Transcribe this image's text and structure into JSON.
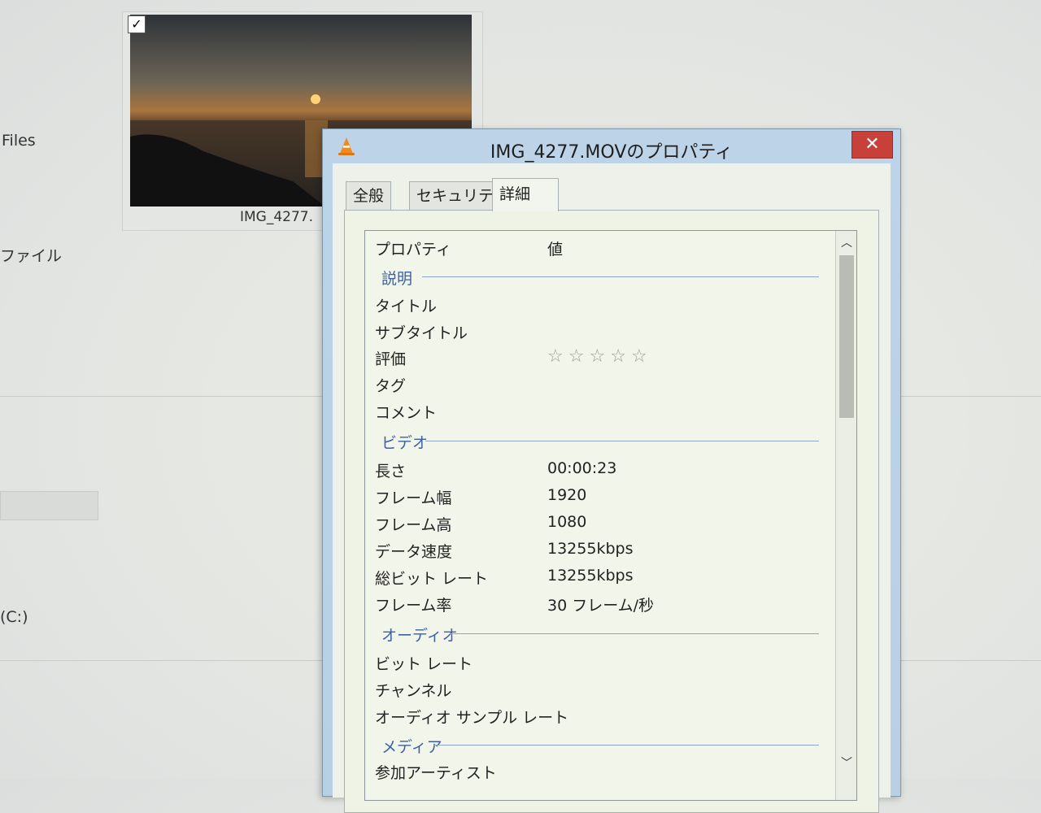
{
  "explorer": {
    "left_items": [
      "Files",
      "ファイル",
      "(C:)"
    ],
    "thumbnail_label": "IMG_4277."
  },
  "dialog": {
    "title": "IMG_4277.MOVのプロパティ",
    "close_glyph": "✕",
    "tabs": [
      {
        "label": "全般",
        "active": false
      },
      {
        "label": "セキュリティ",
        "active": false
      },
      {
        "label": "詳細",
        "active": true
      }
    ],
    "list": {
      "header_property": "プロパティ",
      "header_value": "値",
      "groups": {
        "description": {
          "label": "説明",
          "rows": [
            {
              "label": "タイトル",
              "value": ""
            },
            {
              "label": "サブタイトル",
              "value": ""
            },
            {
              "label": "評価",
              "value": ""
            },
            {
              "label": "タグ",
              "value": ""
            },
            {
              "label": "コメント",
              "value": ""
            }
          ]
        },
        "video": {
          "label": "ビデオ",
          "rows": [
            {
              "label": "長さ",
              "value": "00:00:23"
            },
            {
              "label": "フレーム幅",
              "value": "1920"
            },
            {
              "label": "フレーム高",
              "value": "1080"
            },
            {
              "label": "データ速度",
              "value": "13255kbps"
            },
            {
              "label": "総ビット レート",
              "value": "13255kbps"
            },
            {
              "label": "フレーム率",
              "value": "30 フレーム/秒"
            }
          ]
        },
        "audio": {
          "label": "オーディオ",
          "rows": [
            {
              "label": "ビット レート",
              "value": ""
            },
            {
              "label": "チャンネル",
              "value": ""
            },
            {
              "label": "オーディオ サンプル レート",
              "value": ""
            }
          ]
        },
        "media": {
          "label": "メディア",
          "rows": [
            {
              "label": "参加アーティスト",
              "value": ""
            }
          ]
        }
      },
      "rating_stars": 0,
      "rating_max": 5
    }
  },
  "icons": {
    "app": "vlc-cone-icon",
    "close": "close-icon",
    "scroll_up": "chevron-up-icon",
    "scroll_down": "chevron-down-icon",
    "star": "star-outline-icon"
  },
  "colors": {
    "group_header": "#3b5fa8",
    "close_button": "#c8403a",
    "window_frame": "#bcd3e8"
  }
}
